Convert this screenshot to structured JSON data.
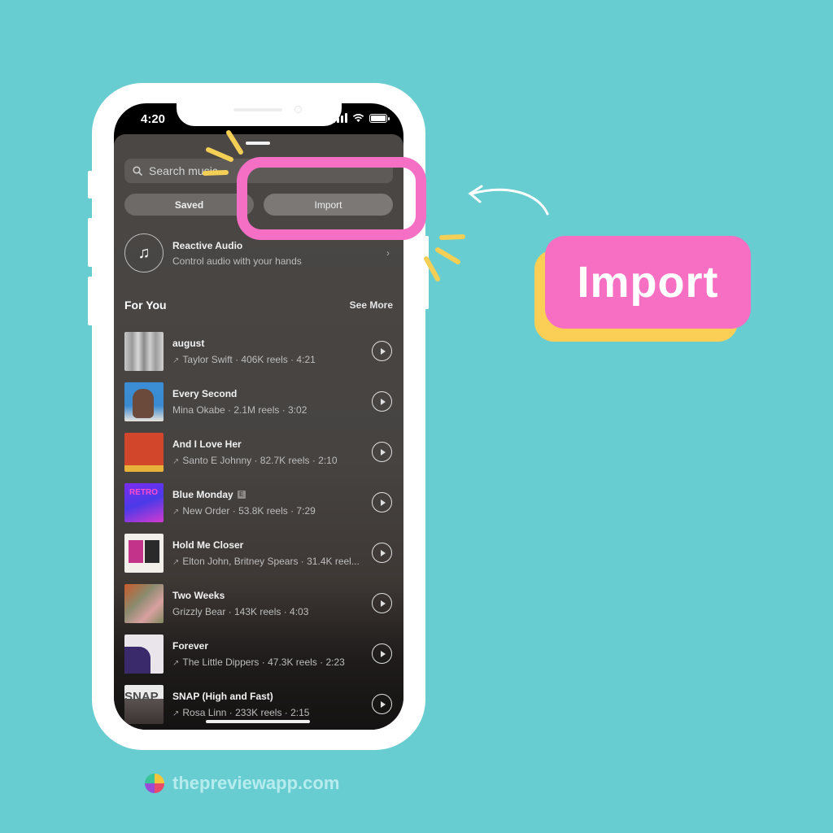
{
  "status_bar": {
    "time": "4:20"
  },
  "search": {
    "placeholder": "Search music"
  },
  "tabs": [
    {
      "label": "Saved"
    },
    {
      "label": "Import"
    }
  ],
  "reactive_audio": {
    "icon": "music-sparkle-icon",
    "title": "Reactive Audio",
    "subtitle": "Control audio with your hands"
  },
  "for_you": {
    "heading": "For You",
    "see_more": "See More",
    "songs": [
      {
        "title": "august",
        "meta": "Taylor Swift · 406K reels · 4:21",
        "trending": true,
        "explicit": false
      },
      {
        "title": "Every Second",
        "meta": "Mina Okabe · 2.1M reels · 3:02",
        "trending": false,
        "explicit": false
      },
      {
        "title": "And I Love Her",
        "meta": "Santo E Johnny · 82.7K reels · 2:10",
        "trending": true,
        "explicit": false
      },
      {
        "title": "Blue Monday",
        "meta": "New Order · 53.8K reels · 7:29",
        "trending": true,
        "explicit": true
      },
      {
        "title": "Hold Me Closer",
        "meta": "Elton John, Britney Spears · 31.4K reel...",
        "trending": true,
        "explicit": false
      },
      {
        "title": "Two Weeks",
        "meta": "Grizzly Bear · 143K reels · 4:03",
        "trending": false,
        "explicit": false
      },
      {
        "title": "Forever",
        "meta": "The Little Dippers · 47.3K reels · 2:23",
        "trending": true,
        "explicit": false
      },
      {
        "title": "SNAP (High and Fast)",
        "meta": "Rosa Linn · 233K reels · 2:15",
        "trending": true,
        "explicit": false
      }
    ],
    "explicit_badge": "E",
    "trending_glyph": "↗"
  },
  "annotation": {
    "callout_label": "Import",
    "colors": {
      "pink": "#f66fc3",
      "yellow": "#fbcf55",
      "teal": "#68cdd1"
    }
  },
  "footer": {
    "url": "thepreviewapp.com"
  }
}
